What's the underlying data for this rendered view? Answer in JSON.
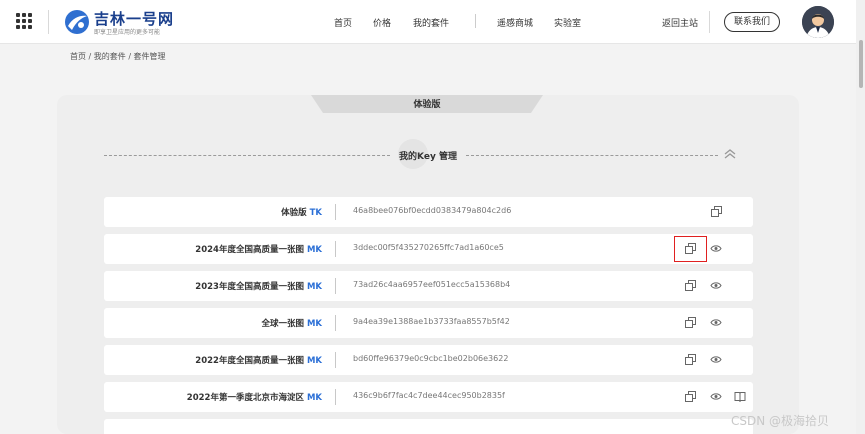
{
  "header": {
    "logo_title": "吉林一号网",
    "logo_subtitle": "即享卫星应用的更多可能",
    "nav": [
      "首页",
      "价格",
      "我的套件",
      "遥感商城",
      "实验室"
    ],
    "back_home": "返回主站",
    "contact": "联系我们"
  },
  "breadcrumb": "首页 / 我的套件 / 套件管理",
  "panel": {
    "tab_label": "体验版",
    "section_title": "我的Key 管理"
  },
  "keys": [
    {
      "label": "体验版",
      "tag": "TK",
      "key": "46a8bee076bf0ecdd0383479a804c2d6"
    },
    {
      "label": "2024年度全国高质量一张图",
      "tag": "MK",
      "key": "3ddec00f5f435270265ffc7ad1a60ce5"
    },
    {
      "label": "2023年度全国高质量一张图",
      "tag": "MK",
      "key": "73ad26c4aa6957eef051ecc5a15368b4"
    },
    {
      "label": "全球一张图",
      "tag": "MK",
      "key": "9a4ea39e1388ae1b3733faa8557b5f42"
    },
    {
      "label": "2022年度全国高质量一张图",
      "tag": "MK",
      "key": "bd60ffe96379e0c9cbc1be02b06e3622"
    },
    {
      "label": "2022年第一季度北京市海淀区",
      "tag": "MK",
      "key": "436c9b6f7fac4c7dee44cec950b2835f"
    }
  ],
  "watermark": "CSDN @极海拾贝",
  "icons": {
    "copy": "copy-icon",
    "view": "eye-icon",
    "doc": "book-icon",
    "collapse": "chevron-double-up-icon",
    "menu": "grid-menu-icon"
  },
  "colors": {
    "accent_blue": "#2b6fd6",
    "highlight_red": "#e02020",
    "brand_navy": "#1a3f8c"
  }
}
